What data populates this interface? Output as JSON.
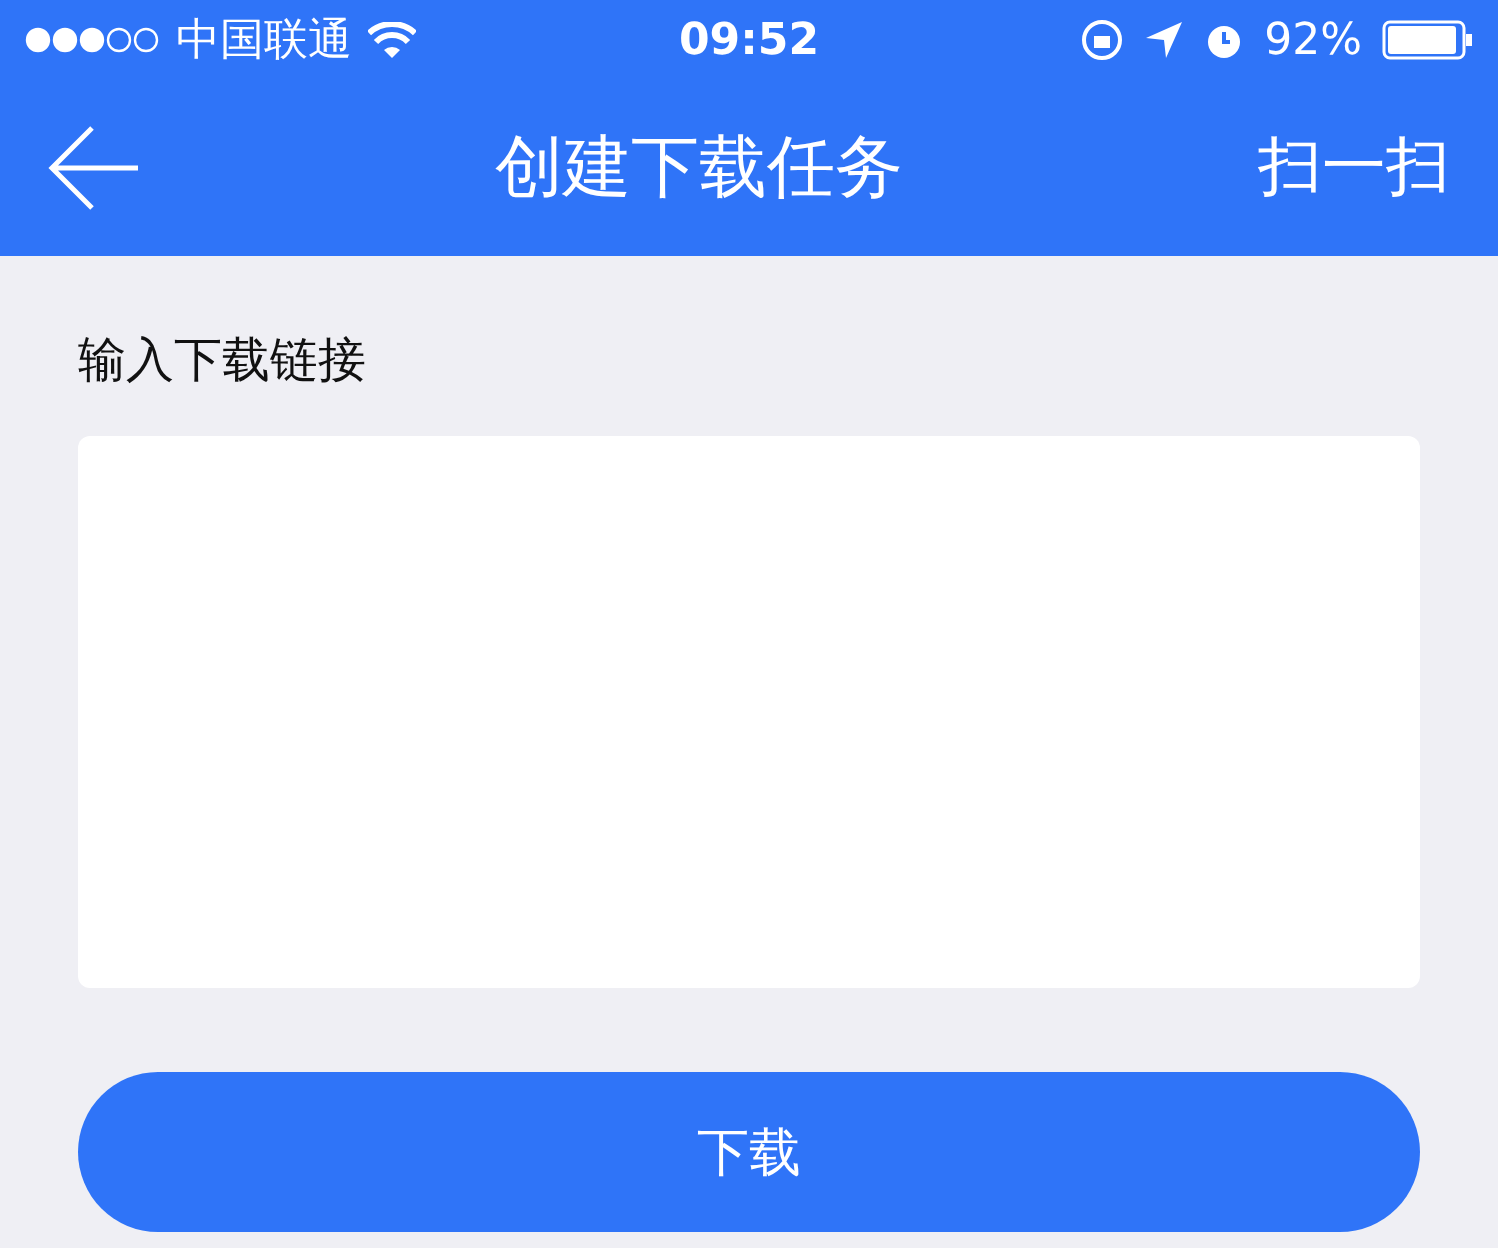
{
  "status_bar": {
    "carrier": "中国联通",
    "time": "09:52",
    "battery": "92%"
  },
  "nav_bar": {
    "title": "创建下载任务",
    "action": "扫一扫"
  },
  "form": {
    "label": "输入下载链接",
    "submit": "下载"
  }
}
